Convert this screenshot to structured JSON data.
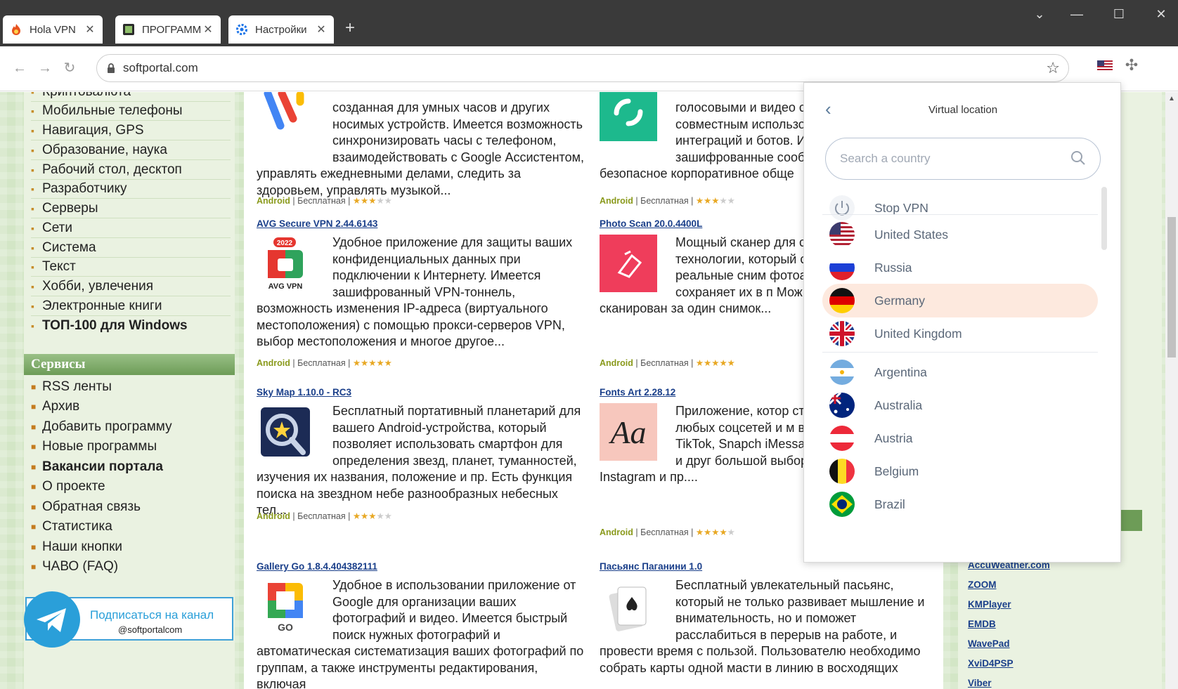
{
  "browser": {
    "tabs": [
      {
        "title": "Hola VPN",
        "icon": "hola-flame-icon"
      },
      {
        "title": "ПРОГРАММ",
        "icon": "softportal-icon"
      },
      {
        "title": "Настройки",
        "icon": "settings-gear-icon"
      }
    ],
    "new_tab": "+",
    "url": "softportal.com"
  },
  "sidebar": {
    "categories": [
      {
        "label": "Криптовалюта"
      },
      {
        "label": "Мобильные телефоны"
      },
      {
        "label": "Навигация, GPS"
      },
      {
        "label": "Образование, наука"
      },
      {
        "label": "Рабочий стол, десктоп"
      },
      {
        "label": "Разработчику"
      },
      {
        "label": "Серверы"
      },
      {
        "label": "Сети"
      },
      {
        "label": "Система"
      },
      {
        "label": "Текст"
      },
      {
        "label": "Хобби, увлечения"
      },
      {
        "label": "Электронные книги"
      },
      {
        "label": "ТОП-100 для Windows"
      }
    ],
    "services_title": "Сервисы",
    "services": [
      {
        "label": "RSS ленты"
      },
      {
        "label": "Архив"
      },
      {
        "label": "Добавить программу"
      },
      {
        "label": "Новые программы"
      },
      {
        "label": "Вакансии портала"
      },
      {
        "label": "О проекте"
      },
      {
        "label": "Обратная связь"
      },
      {
        "label": "Статистика"
      },
      {
        "label": "Наши кнопки"
      },
      {
        "label": "ЧАВО (FAQ)"
      }
    ],
    "telegram": {
      "title": "Подписаться на канал",
      "handle": "@softportalcom"
    }
  },
  "apps": [
    {
      "name": "",
      "desc": "созданная для умных часов и других носимых устройств. Имеется возможность синхронизировать часы с телефоном, взаимодействовать с Google Ассистентом, управлять ежедневными делами, следить за здоровьем, управлять музыкой...",
      "os": "Android",
      "license": "Бесплатная",
      "rating": 3
    },
    {
      "name": "",
      "desc": "голосовыми и видео совместным исполь совместным использованием экр интеграций и ботов. Имеются по зашифрованные сообщения, обе безопасное корпоративное обще",
      "os": "Android",
      "license": "Бесплатная",
      "rating": 3
    },
    {
      "name": "AVG Secure VPN 2.44.6143",
      "desc": "Удобное приложение для защиты ваших конфиденциальных данных при подключении к Интернету. Имеется зашифрованный VPN-тоннель, возможность изменения IP-адреса (виртуального местоположения) с помощью прокси-серверов VPN, выбор местоположения и многое другое...",
      "os": "Android",
      "license": "Бесплатная",
      "rating": 5,
      "badge": "2022",
      "caption": "AVG VPN"
    },
    {
      "name": "Photo Scan 20.0.4400L",
      "desc": "Мощный сканер для с использованием п технологии, который сканировать ваши реальные сним фотоальбомов) и сохраняет их в п Можно осуществлять сканирован за один снимок...",
      "os": "Android",
      "license": "Бесплатная",
      "rating": 5
    },
    {
      "name": "Sky Map 1.10.0 - RC3",
      "desc": "Бесплатный портативный планетарий для вашего Android-устройства, который позволяет использовать смартфон для определения звезд, планет, туманностей, изучения их названия, положение и пр. Есть функция поиска на звездном небе разнообразных небесных тел...",
      "os": "Android",
      "license": "Бесплатная",
      "rating": 3
    },
    {
      "name": "Fonts Art 2.28.12",
      "desc": "Приложение, котор стильных и необычн любых соцсетей и м включая Instagram, TikTok, Snapch iMessage, WhatsApp, Skype и друг большой выбор символов, шабло Instagram и пр....",
      "os": "Android",
      "license": "Бесплатная",
      "rating": 4,
      "glyph": "Aa"
    },
    {
      "name": "Gallery Go 1.8.4.404382111",
      "desc": "Удобное в использовании приложение от Google для организации ваших фотографий и видео. Имеется быстрый поиск нужных фотографий и автоматическая систематизация ваших фотографий по группам, а также инструменты редактирования, включая",
      "caption": "GO"
    },
    {
      "name": "Пасьянс Паганини 1.0",
      "desc": "Бесплатный увлекательный пасьянс, который не только развивает мышление и внимательность, но и поможет расслабиться в перерыв на работе, и провести время с пользой. Пользователю необходимо собрать карты одной масти в линию в восходящих"
    }
  ],
  "right_links": [
    {
      "label": "AccuWeather.com"
    },
    {
      "label": "ZOOM"
    },
    {
      "label": "KMPlayer"
    },
    {
      "label": "EMDB"
    },
    {
      "label": "WavePad"
    },
    {
      "label": "XviD4PSP"
    },
    {
      "label": "Viber"
    }
  ],
  "vpn": {
    "title": "Virtual location",
    "search_placeholder": "Search a country",
    "stop_label": "Stop VPN",
    "recent": [
      {
        "name": "United States",
        "flag": "us"
      },
      {
        "name": "Russia",
        "flag": "ru"
      },
      {
        "name": "Germany",
        "flag": "de",
        "selected": true
      },
      {
        "name": "United Kingdom",
        "flag": "gb"
      }
    ],
    "countries": [
      {
        "name": "Argentina",
        "flag": "ar"
      },
      {
        "name": "Australia",
        "flag": "au"
      },
      {
        "name": "Austria",
        "flag": "at"
      },
      {
        "name": "Belgium",
        "flag": "be"
      },
      {
        "name": "Brazil",
        "flag": "br"
      }
    ],
    "highlight_color": "#fde9de"
  }
}
